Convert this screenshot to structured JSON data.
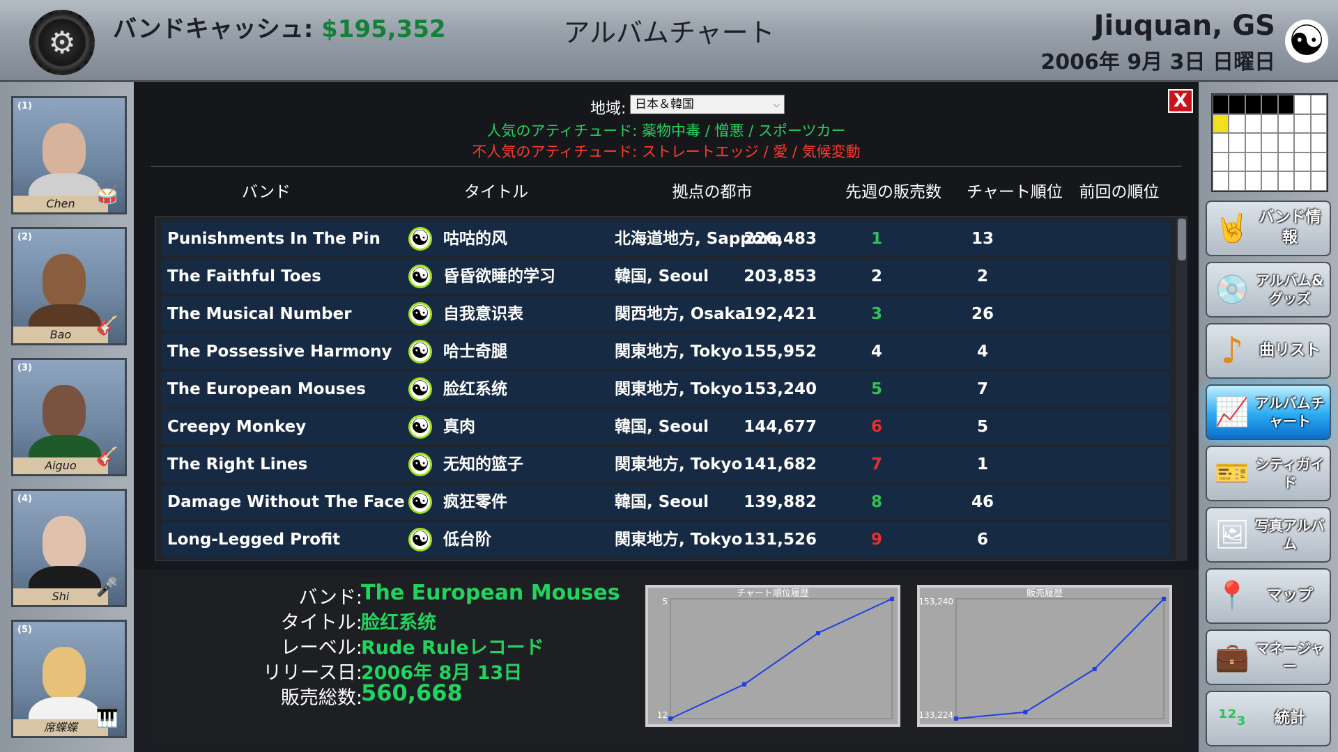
{
  "header": {
    "cash_label": "バンドキャッシュ: ",
    "cash_value": "$195,352",
    "title": "アルバムチャート",
    "city": "Jiuquan, GS",
    "date": "2006年 9月 3日 日曜日",
    "gear_icon": "gear-icon",
    "yinyang_icon": "yinyang-icon"
  },
  "members": [
    {
      "num": "(1)",
      "name": "Chen",
      "instrument_icon": "drum-icon"
    },
    {
      "num": "(2)",
      "name": "Bao",
      "instrument_icon": "guitar-icon"
    },
    {
      "num": "(3)",
      "name": "Aiguo",
      "instrument_icon": "guitar-icon"
    },
    {
      "num": "(4)",
      "name": "Shi",
      "instrument_icon": "microphone-icon"
    },
    {
      "num": "(5)",
      "name": "席蝶蝶",
      "instrument_icon": "keyboard-icon"
    }
  ],
  "filter": {
    "region_label": "地域:",
    "region_value": "日本＆韓国",
    "popular": "人気のアティチュード: 薬物中毒 / 憎悪 / スポーツカー",
    "unpopular": "不人気のアティチュード: ストレートエッジ / 愛 / 気候変動",
    "close_label": "X"
  },
  "table": {
    "headers": [
      "バンド",
      "タイトル",
      "拠点の都市",
      "先週の販売数",
      "チャート順位",
      "前回の順位"
    ],
    "rows": [
      {
        "band": "Punishments In The Pin",
        "title": "咕咕的风",
        "city": "北海道地方, Sapporo",
        "sales": "226,483",
        "rank": "1",
        "prev": "13",
        "trend": "up"
      },
      {
        "band": "The Faithful Toes",
        "title": "昏昏欲睡的学习",
        "city": "韓国, Seoul",
        "sales": "203,853",
        "rank": "2",
        "prev": "2",
        "trend": "same"
      },
      {
        "band": "The Musical Number",
        "title": "自我意识表",
        "city": "関西地方, Osaka",
        "sales": "192,421",
        "rank": "3",
        "prev": "26",
        "trend": "up"
      },
      {
        "band": "The Possessive Harmony",
        "title": "哈士奇腿",
        "city": "関東地方, Tokyo",
        "sales": "155,952",
        "rank": "4",
        "prev": "4",
        "trend": "same"
      },
      {
        "band": "The European Mouses",
        "title": "脸红系统",
        "city": "関東地方, Tokyo",
        "sales": "153,240",
        "rank": "5",
        "prev": "7",
        "trend": "up"
      },
      {
        "band": "Creepy Monkey",
        "title": "真肉",
        "city": "韓国, Seoul",
        "sales": "144,677",
        "rank": "6",
        "prev": "5",
        "trend": "down"
      },
      {
        "band": "The Right Lines",
        "title": "无知的篮子",
        "city": "関東地方, Tokyo",
        "sales": "141,682",
        "rank": "7",
        "prev": "1",
        "trend": "down"
      },
      {
        "band": "Damage Without The Face",
        "title": "疯狂零件",
        "city": "韓国, Seoul",
        "sales": "139,882",
        "rank": "8",
        "prev": "46",
        "trend": "up"
      },
      {
        "band": "Long-Legged Profit",
        "title": "低台阶",
        "city": "関東地方, Tokyo",
        "sales": "131,526",
        "rank": "9",
        "prev": "6",
        "trend": "down"
      }
    ]
  },
  "detail": {
    "band_label": "バンド:",
    "band_value": "The European Mouses",
    "title_label": "タイトル:",
    "title_value": "脸红系统",
    "label_label": "レーベル:",
    "label_value": "Rude Ruleレコード",
    "release_label": "リリース日:",
    "release_value": "2006年 8月 13日",
    "total_label": "販売総数:",
    "total_value": "560,668"
  },
  "nav": [
    {
      "label": "バンド情報",
      "icon": "rock-hand-icon",
      "active": false
    },
    {
      "label": "アルバム&グッズ",
      "icon": "cd-icon",
      "active": false
    },
    {
      "label": "曲リスト",
      "icon": "music-note-icon",
      "active": false
    },
    {
      "label": "アルバムチャート",
      "icon": "chart-icon",
      "active": true
    },
    {
      "label": "シティガイド",
      "icon": "ticket-icon",
      "active": false
    },
    {
      "label": "写真アルバム",
      "icon": "photo-icon",
      "active": false
    },
    {
      "label": "マップ",
      "icon": "map-pin-icon",
      "active": false
    },
    {
      "label": "マネージャー",
      "icon": "briefcase-icon",
      "active": false
    },
    {
      "label": "統計",
      "icon": "numbers-icon",
      "active": false
    }
  ],
  "calendar": {
    "filled_cells": [
      0,
      1,
      2,
      3,
      4
    ],
    "highlight_cell": 7
  },
  "chart_data": [
    {
      "type": "line",
      "title": "チャート順位履歴",
      "y_top_label": "5",
      "y_bottom_label": "12",
      "ylim": [
        12,
        5
      ],
      "x": [
        1,
        2,
        3,
        4
      ],
      "values": [
        12,
        10,
        7,
        5
      ],
      "color": "#1f3fe0"
    },
    {
      "type": "line",
      "title": "販売履歴",
      "y_top_label": "153,240",
      "y_bottom_label": "133,224",
      "ylim": [
        133224,
        153240
      ],
      "x": [
        1,
        2,
        3,
        4
      ],
      "values": [
        133224,
        134300,
        141500,
        153240
      ],
      "color": "#1f3fe0"
    }
  ]
}
